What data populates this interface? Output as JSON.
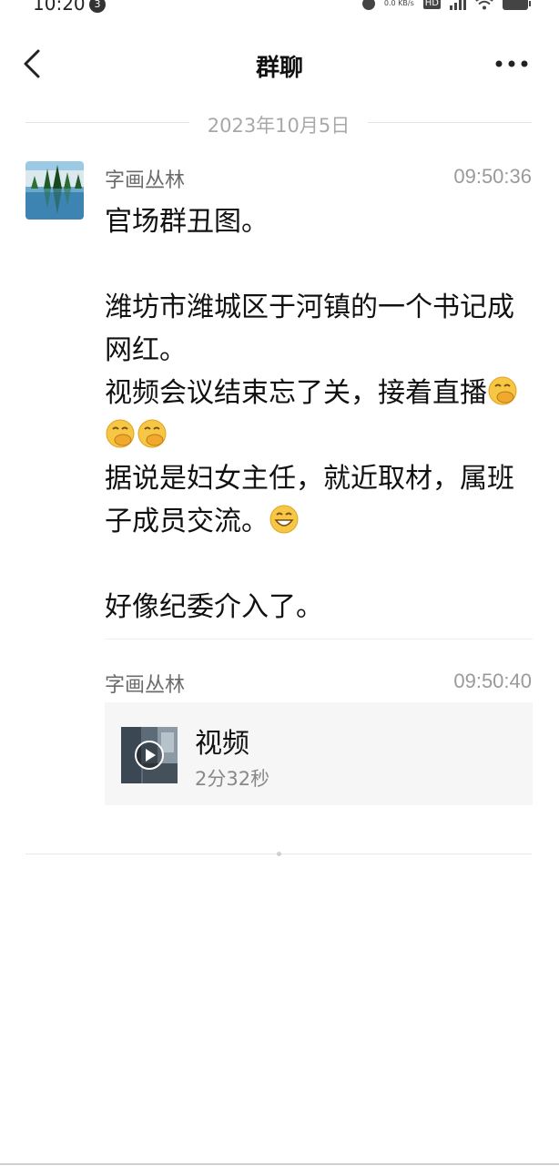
{
  "status_bar": {
    "time": "10:20",
    "notification_count": "3",
    "network_speed": "0.0 KB/s",
    "network_label": "HD"
  },
  "nav": {
    "title": "群聊",
    "back_icon": "chevron-left-icon",
    "more_icon": "more-horizontal-icon"
  },
  "date_divider": "2023年10月5日",
  "messages": [
    {
      "sender": "字画丛林",
      "time": "09:50:36",
      "lines": [
        "官场群丑图。",
        "",
        "潍坊市潍城区于河镇的一个书记成网红。",
        "视频会议结束忘了关，接着直播",
        "据说是妇女主任，就近取材，属班子成员交流。",
        "",
        "好像纪委介入了。"
      ],
      "emojis": [
        "hand-over-mouth-emoji",
        "hand-over-mouth-emoji",
        "hand-over-mouth-emoji",
        "grinning-emoji"
      ]
    },
    {
      "sender": "字画丛林",
      "time": "09:50:40",
      "video": {
        "title": "视频",
        "duration": "2分32秒",
        "icon": "play-icon"
      }
    }
  ],
  "colors": {
    "background": "#ffffff",
    "secondary_text": "#6b6b6b",
    "time_text": "#9a9a9a",
    "card_background": "#f6f6f6"
  }
}
